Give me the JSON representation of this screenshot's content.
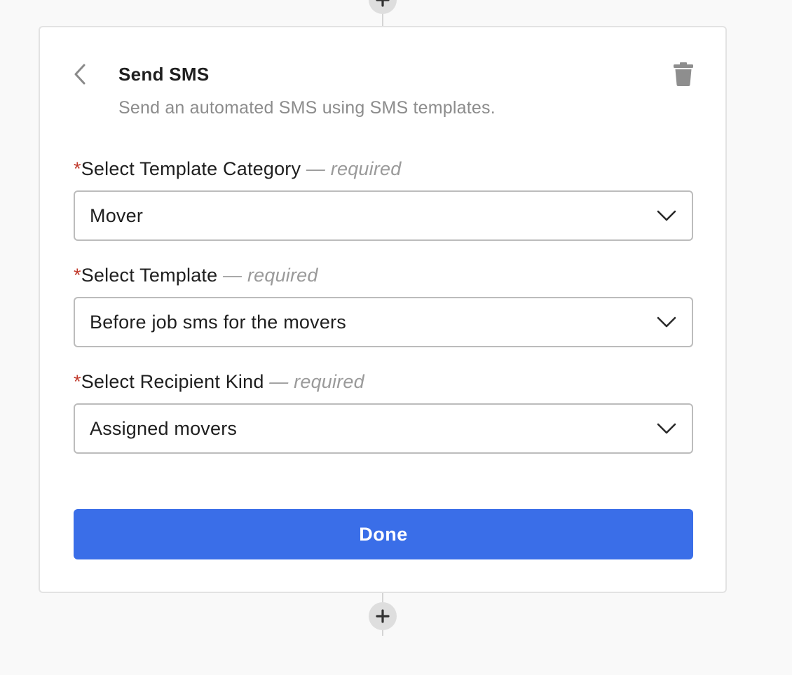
{
  "step": {
    "title": "Send SMS",
    "description": "Send an automated SMS using SMS templates."
  },
  "fields": [
    {
      "star": "*",
      "label": "Select Template Category",
      "required_text": " — required",
      "value": "Mover"
    },
    {
      "star": "*",
      "label": "Select Template",
      "required_text": " — required",
      "value": "Before job sms for the movers"
    },
    {
      "star": "*",
      "label": "Select Recipient Kind",
      "required_text": " — required",
      "value": "Assigned movers"
    }
  ],
  "actions": {
    "done_label": "Done"
  },
  "icons": {
    "back": "chevron-left-icon",
    "delete": "trash-icon",
    "dropdown": "chevron-down-icon",
    "add": "plus-icon"
  },
  "colors": {
    "primary": "#3a6ee8",
    "required_star": "#c0392b",
    "muted_text": "#8c8c8c"
  }
}
